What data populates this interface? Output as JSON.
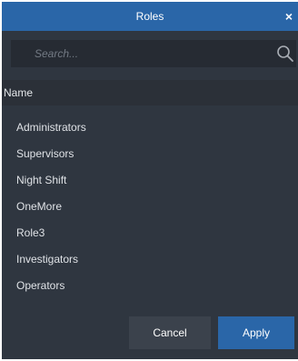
{
  "dialog": {
    "title": "Roles",
    "close_symbol": "×"
  },
  "search": {
    "placeholder": "Search...",
    "value": "",
    "icon": "search-icon"
  },
  "table": {
    "column_header": "Name"
  },
  "roles": [
    {
      "label": "Administrators"
    },
    {
      "label": "Supervisors"
    },
    {
      "label": "Night Shift"
    },
    {
      "label": "OneMore"
    },
    {
      "label": "Role3"
    },
    {
      "label": "Investigators"
    },
    {
      "label": "Operators"
    }
  ],
  "buttons": {
    "cancel_label": "Cancel",
    "apply_label": "Apply"
  },
  "colors": {
    "accent": "#2a66a8",
    "background": "#2f3640"
  }
}
